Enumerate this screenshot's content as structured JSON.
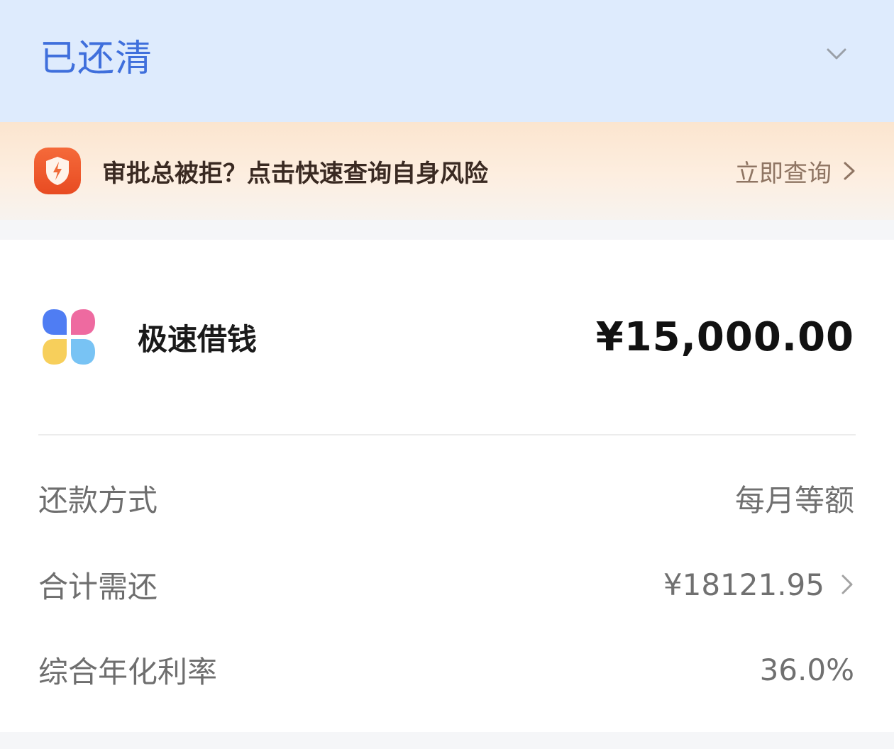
{
  "header": {
    "status": "已还清",
    "accent_color": "#3f6fdc",
    "background_color": "#deebfd"
  },
  "risk_banner": {
    "icon": "shield-lightning-icon",
    "text": "审批总被拒？点击快速查询自身风险",
    "action_label": "立即查询"
  },
  "loan": {
    "product_icon": "four-petal-logo-icon",
    "product_name": "极速借钱",
    "amount": "¥15,000.00",
    "details": [
      {
        "label": "还款方式",
        "value": "每月等额"
      },
      {
        "label": "合计需还",
        "value": "¥18121.95"
      },
      {
        "label": "综合年化利率",
        "value": "36.0%"
      }
    ]
  }
}
